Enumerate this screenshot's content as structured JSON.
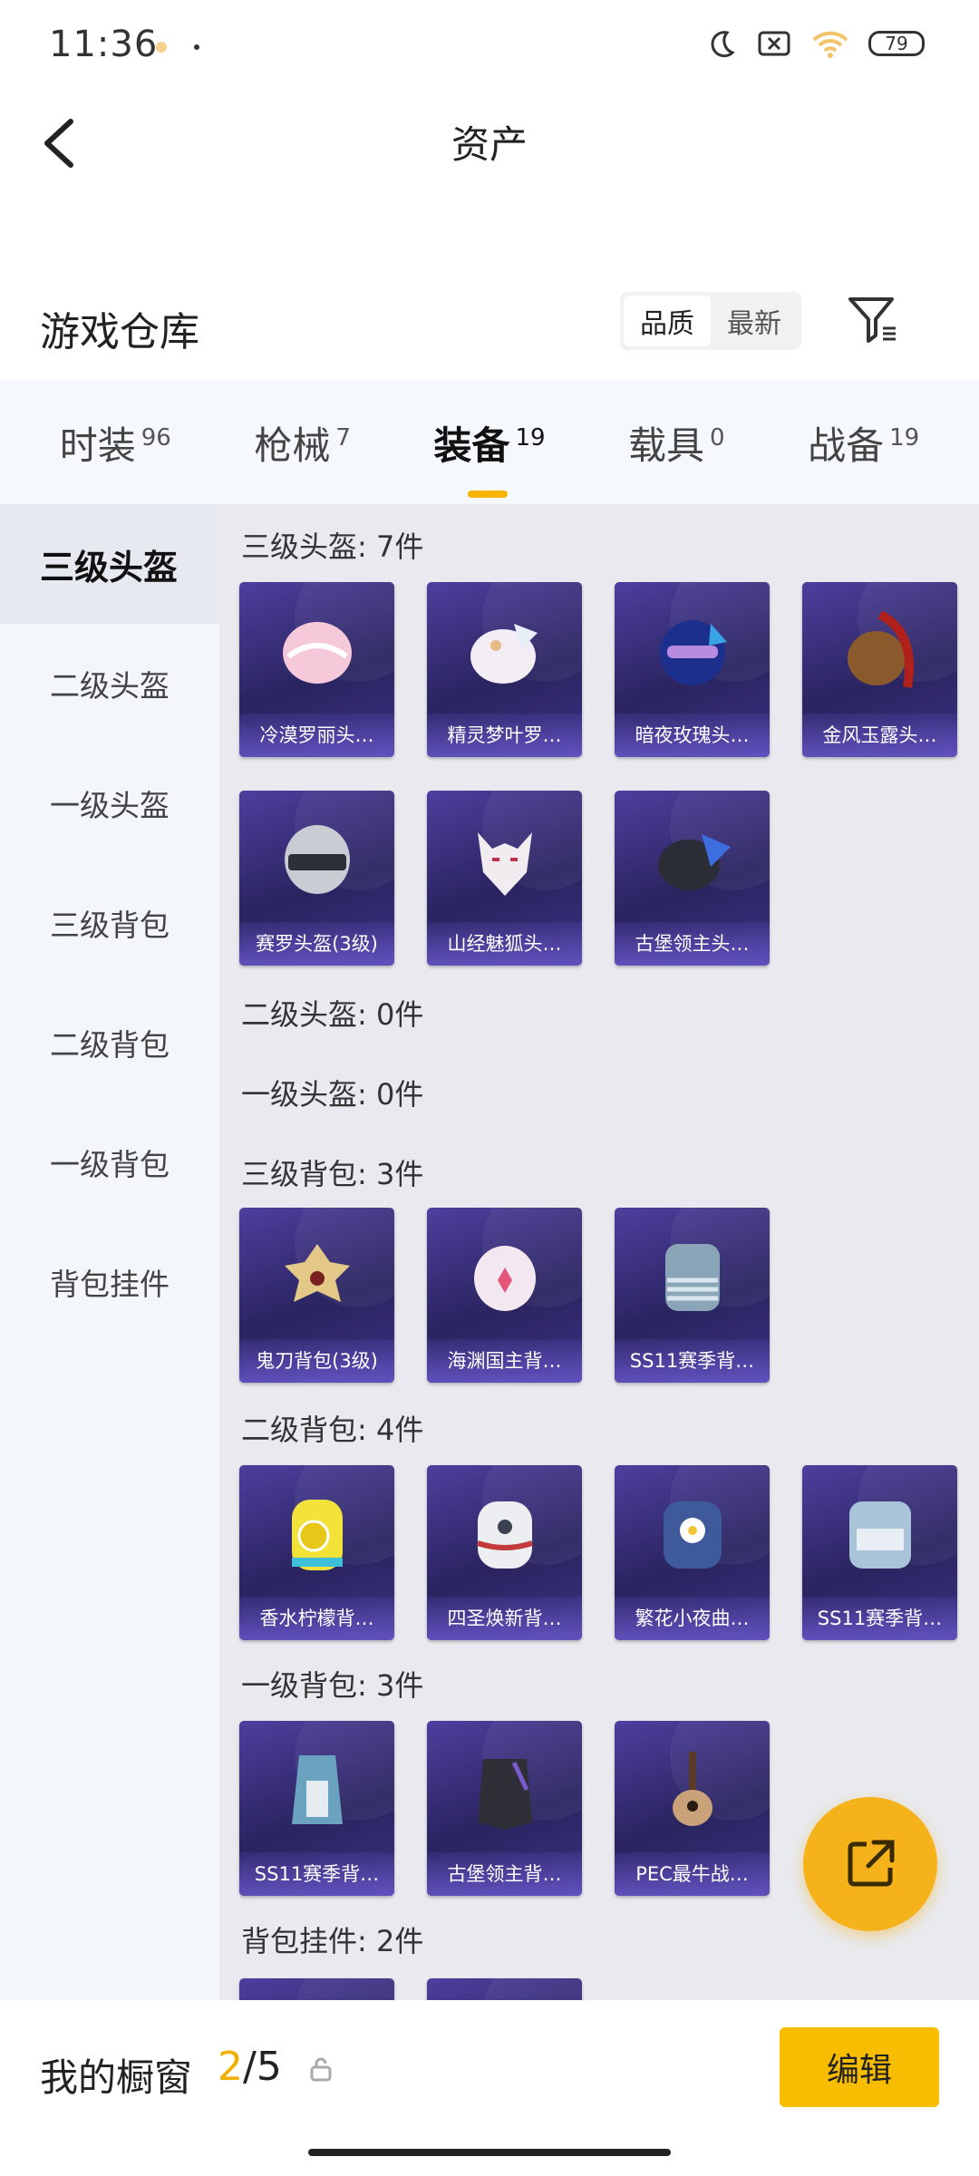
{
  "status": {
    "time": "11:36",
    "battery": "79"
  },
  "header": {
    "title": "资产"
  },
  "warehouse": {
    "label": "游戏仓库",
    "sort_options": [
      "品质",
      "最新"
    ],
    "active_sort": "品质"
  },
  "tabs": [
    {
      "label": "时装",
      "count": "96"
    },
    {
      "label": "枪械",
      "count": "7"
    },
    {
      "label": "装备",
      "count": "19"
    },
    {
      "label": "载具",
      "count": "0"
    },
    {
      "label": "战备",
      "count": "19"
    }
  ],
  "sidebar": [
    {
      "label": "三级头盔"
    },
    {
      "label": "二级头盔"
    },
    {
      "label": "一级头盔"
    },
    {
      "label": "三级背包"
    },
    {
      "label": "二级背包"
    },
    {
      "label": "一级背包"
    },
    {
      "label": "背包挂件"
    }
  ],
  "sections": [
    {
      "title": "三级头盔: 7件",
      "items": [
        "冷漠罗丽头…",
        "精灵梦叶罗…",
        "暗夜玫瑰头…",
        "金风玉露头…",
        "赛罗头盔(3级)",
        "山经魅狐头…",
        "古堡领主头…"
      ]
    },
    {
      "title": "二级头盔: 0件",
      "items": []
    },
    {
      "title": "一级头盔: 0件",
      "items": []
    },
    {
      "title": "三级背包: 3件",
      "items": [
        "鬼刀背包(3级)",
        "海渊国主背…",
        "SS11赛季背…"
      ]
    },
    {
      "title": "二级背包: 4件",
      "items": [
        "香水柠檬背…",
        "四圣焕新背…",
        "繁花小夜曲…",
        "SS11赛季背…"
      ]
    },
    {
      "title": "一级背包: 3件",
      "items": [
        "SS11赛季背…",
        "古堡领主背…",
        "PEC最牛战…"
      ]
    },
    {
      "title": "背包挂件: 2件",
      "items": []
    }
  ],
  "showcase": {
    "label": "我的橱窗",
    "current": "2",
    "total": "/5",
    "edit_label": "编辑"
  },
  "colors": {
    "accent": "#f9bd00",
    "card_bg": "#2a2460"
  }
}
